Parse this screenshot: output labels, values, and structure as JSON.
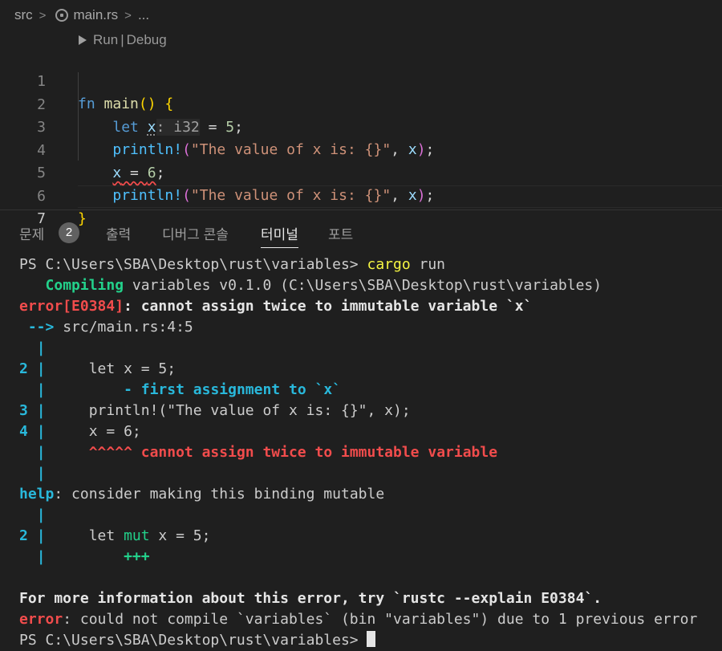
{
  "breadcrumb": {
    "folder": "src",
    "file": "main.rs",
    "more": "..."
  },
  "codelens": {
    "run": "Run",
    "sep": "|",
    "debug": "Debug"
  },
  "code": {
    "line_numbers": [
      "1",
      "2",
      "3",
      "4",
      "5",
      "6",
      "7"
    ],
    "l1": {
      "kw": "fn",
      "name": "main",
      "open": "()",
      "sp": " ",
      "brace": "{"
    },
    "l2": {
      "kw": "let",
      "var": "x",
      "hint": ": i32",
      "eq": " = ",
      "num": "5",
      "end": ";"
    },
    "l3": {
      "mac": "println!",
      "open": "(",
      "str": "\"The value of x is: {}\"",
      "comma": ", ",
      "var": "x",
      "close": ")",
      "end": ";"
    },
    "l4": {
      "var": "x",
      "eq": " = ",
      "num": "6",
      "end": ";"
    },
    "l5": {
      "mac": "println!",
      "open": "(",
      "str": "\"The value of x is: {}\"",
      "comma": ", ",
      "var": "x",
      "close": ")",
      "end": ";"
    },
    "l6": {
      "brace": "}"
    }
  },
  "panel": {
    "tabs": [
      "문제",
      "출력",
      "디버그 콘솔",
      "터미널",
      "포트"
    ],
    "problems_count": "2",
    "active_tab": "터미널"
  },
  "terminal": {
    "prompt1": "PS C:\\Users\\SBA\\Desktop\\rust\\variables> ",
    "cmd1": "cargo",
    "cmd1_arg": " run",
    "compiling_label": "Compiling",
    "compiling_rest": " variables v0.1.0 (C:\\Users\\SBA\\Desktop\\rust\\variables)",
    "error_code": "error[E0384]",
    "error_msg": ": cannot assign twice to immutable variable `x`",
    "arrow": "-->",
    "location": " src/main.rs:4:5",
    "gutter": "|",
    "ln2": "2",
    "ln3": "3",
    "ln4": "4",
    "src2": "let x = 5;",
    "note_first": "- first assignment to `x`",
    "src3": "println!(\"The value of x is: {}\", x);",
    "src4": "x = 6;",
    "note_cannot": "^^^^^ cannot assign twice to immutable variable",
    "help_label": "help",
    "help_msg": ": consider making this binding mutable",
    "src2b_pre": "let ",
    "src2b_mut": "mut",
    "src2b_post": " x = 5;",
    "plus": "+++",
    "more_info": "For more information about this error, try `rustc --explain E0384`.",
    "final_err_label": "error",
    "final_err_msg": ": could not compile `variables` (bin \"variables\") due to 1 previous error",
    "prompt2": "PS C:\\Users\\SBA\\Desktop\\rust\\variables> "
  },
  "colors": {
    "background": "#1f1f1f",
    "error_red": "#f14c4c",
    "ok_green": "#23d18b",
    "info_cyan": "#29b8db",
    "cargo_yellow": "#f5f543"
  }
}
